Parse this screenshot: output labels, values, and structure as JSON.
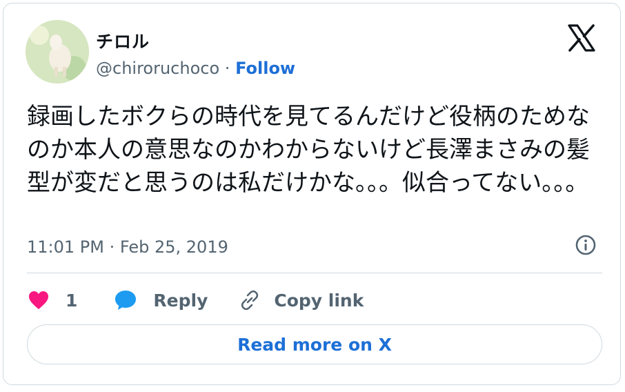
{
  "user": {
    "name": "チロル",
    "handle": "@chiroruchoco",
    "separator": "·",
    "follow_label": "Follow"
  },
  "tweet": {
    "text": "録画したボクらの時代を見てるんだけど役柄のためなのか本人の意思なのかわからないけど長澤まさみの髪型が変だと思うのは私だけかな。。。似合ってない。。。",
    "timestamp": "11:01 PM · Feb 25, 2019"
  },
  "actions": {
    "like_count": "1",
    "reply_label": "Reply",
    "copy_link_label": "Copy link"
  },
  "read_more_label": "Read more on X",
  "icons": {
    "brand": "x-logo-icon",
    "like": "heart-icon",
    "reply": "speech-bubble-icon",
    "copy": "link-icon",
    "info": "info-icon"
  },
  "colors": {
    "accent": "#1d6fd6",
    "like": "#f91880",
    "reply": "#1d9bf0",
    "muted": "#536471",
    "border": "#cfd9de"
  }
}
